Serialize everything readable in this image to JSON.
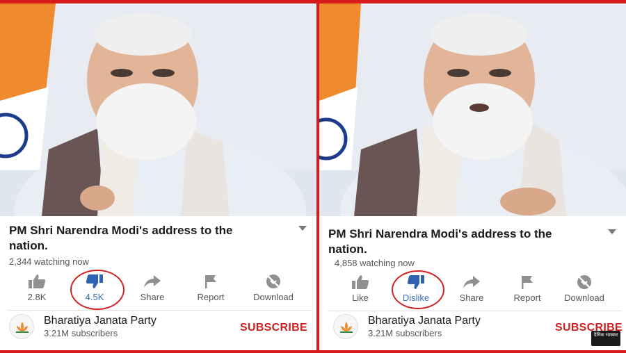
{
  "left": {
    "title": "PM Shri Narendra Modi's address to the nation.",
    "watching": "2,344 watching now",
    "actions": [
      {
        "label": "2.8K",
        "icon": "thumbs-up-icon"
      },
      {
        "label": "4.5K",
        "icon": "thumbs-down-icon"
      },
      {
        "label": "Share",
        "icon": "share-icon"
      },
      {
        "label": "Report",
        "icon": "flag-icon"
      },
      {
        "label": "Download",
        "icon": "download-icon"
      }
    ],
    "channel": {
      "name": "Bharatiya Janata Party",
      "subscribers": "3.21M subscribers"
    },
    "subscribe": "SUBSCRIBE"
  },
  "right": {
    "title": "PM Shri Narendra Modi's address to the nation.",
    "watching": "4,858 watching now",
    "actions": [
      {
        "label": "Like",
        "icon": "thumbs-up-icon"
      },
      {
        "label": "Dislike",
        "icon": "thumbs-down-icon"
      },
      {
        "label": "Share",
        "icon": "share-icon"
      },
      {
        "label": "Report",
        "icon": "flag-icon"
      },
      {
        "label": "Download",
        "icon": "download-icon"
      }
    ],
    "channel": {
      "name": "Bharatiya Janata Party",
      "subscribers": "3.21M subscribers"
    },
    "subscribe": "SUBSCRIBE"
  },
  "watermark": "दैनिक भास्कर",
  "colors": {
    "accent_red": "#d81a1a",
    "active_blue": "#3a6fbd",
    "icon_gray": "#909090"
  }
}
